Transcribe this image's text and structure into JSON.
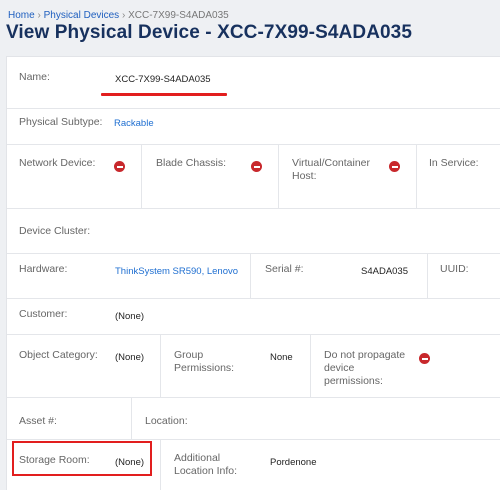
{
  "breadcrumb": {
    "items": [
      "Home",
      "Physical Devices",
      "XCC-7X99-S4ADA035"
    ],
    "separator": "›"
  },
  "page_title": "View Physical Device - XCC-7X99-S4ADA035",
  "fields": {
    "name": {
      "label": "Name:",
      "value": "XCC-7X99-S4ADA035"
    },
    "physical_subtype": {
      "label": "Physical Subtype:",
      "value": "Rackable"
    },
    "network_device": {
      "label": "Network Device:",
      "state_icon": "minus-circle-icon"
    },
    "blade_chassis": {
      "label": "Blade Chassis:",
      "state_icon": "minus-circle-icon"
    },
    "virtual_container_host": {
      "label_line1": "Virtual/Container",
      "label_line2": "Host:",
      "state_icon": "minus-circle-icon"
    },
    "in_service": {
      "label": "In Service:"
    },
    "device_cluster": {
      "label": "Device Cluster:"
    },
    "hardware": {
      "label": "Hardware:",
      "value": "ThinkSystem SR590, Lenovo"
    },
    "serial": {
      "label": "Serial #:",
      "value": "S4ADA035"
    },
    "uuid": {
      "label": "UUID:"
    },
    "customer": {
      "label": "Customer:",
      "value": "(None)"
    },
    "object_category": {
      "label": "Object Category:",
      "value": "(None)"
    },
    "group_permissions": {
      "label_line1": "Group",
      "label_line2": "Permissions:",
      "value": "None"
    },
    "do_not_propagate": {
      "label_line1": "Do not propagate",
      "label_line2": "device",
      "label_line3": "permissions:",
      "state_icon": "minus-circle-icon"
    },
    "asset": {
      "label": "Asset #:"
    },
    "location": {
      "label": "Location:"
    },
    "storage_room": {
      "label": "Storage Room:",
      "value": "(None)"
    },
    "additional_location_info": {
      "label_line1": "Additional",
      "label_line2": "Location Info:",
      "value": "Pordenone"
    }
  },
  "colors": {
    "title": "#17315e",
    "link": "#1f6fd1",
    "annotation_red": "#e21e1e",
    "minus_icon": "#c8282c"
  }
}
